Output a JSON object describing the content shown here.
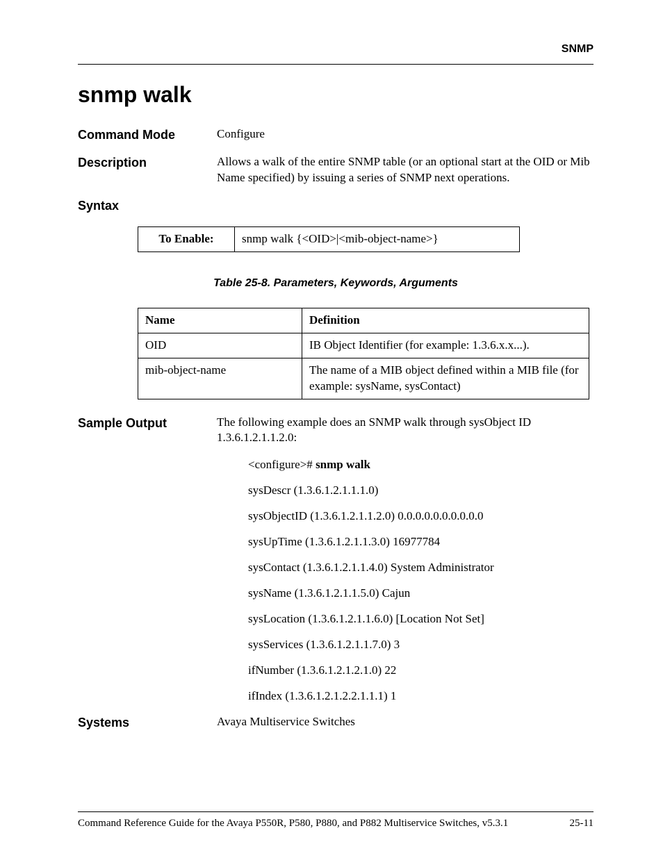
{
  "header": {
    "chapter": "SNMP"
  },
  "title": "snmp walk",
  "command_mode": {
    "label": "Command Mode",
    "value": "Configure"
  },
  "description": {
    "label": "Description",
    "value": "Allows a walk of the entire SNMP table (or an optional start at the OID or Mib Name specified) by issuing a series of SNMP next operations."
  },
  "syntax": {
    "label": "Syntax",
    "to_enable_label": "To Enable:",
    "to_enable_value": "snmp walk {<OID>|<mib-object-name>}"
  },
  "params_table": {
    "caption": "Table 25-8.  Parameters, Keywords, Arguments",
    "headers": [
      "Name",
      "Definition"
    ],
    "rows": [
      {
        "name": "OID",
        "def": "IB Object Identifier (for example: 1.3.6.x.x...)."
      },
      {
        "name": "mib-object-name",
        "def": "The name of a MIB object defined within a MIB file (for example: sysName, sysContact)"
      }
    ]
  },
  "sample_output": {
    "label": "Sample Output",
    "intro": "The following example does an SNMP walk through sysObject ID 1.3.6.1.2.1.1.2.0:",
    "prompt_prefix": "<configure># ",
    "prompt_cmd": "snmp walk",
    "lines": [
      "sysDescr (1.3.6.1.2.1.1.1.0)",
      "sysObjectID (1.3.6.1.2.1.1.2.0) 0.0.0.0.0.0.0.0.0.0",
      "sysUpTime (1.3.6.1.2.1.1.3.0) 16977784",
      "sysContact (1.3.6.1.2.1.1.4.0) System Administrator",
      "sysName (1.3.6.1.2.1.1.5.0) Cajun",
      "sysLocation (1.3.6.1.2.1.1.6.0) [Location Not Set]",
      "sysServices (1.3.6.1.2.1.1.7.0) 3",
      "ifNumber (1.3.6.1.2.1.2.1.0) 22",
      "ifIndex (1.3.6.1.2.1.2.2.1.1.1) 1"
    ]
  },
  "systems": {
    "label": "Systems",
    "value": "Avaya Multiservice Switches"
  },
  "footer": {
    "left": "Command Reference Guide for the Avaya P550R, P580, P880, and P882 Multiservice Switches, v5.3.1",
    "right": "25-11"
  }
}
